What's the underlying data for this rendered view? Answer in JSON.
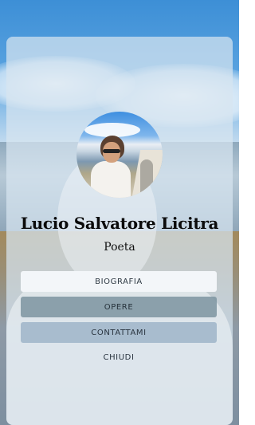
{
  "profile": {
    "name": "Lucio Salvatore Licitra",
    "role": "Poeta"
  },
  "menu": {
    "biografia": "BIOGRAFIA",
    "opere": "OPERE",
    "contattami": "CONTATTAMI",
    "chiudi": "CHIUDI"
  },
  "colors": {
    "card_overlay": "#d7e4f0",
    "button_primary": "#f3f6f9",
    "button_active": "#7d94a0",
    "button_secondary": "#96aec4"
  }
}
